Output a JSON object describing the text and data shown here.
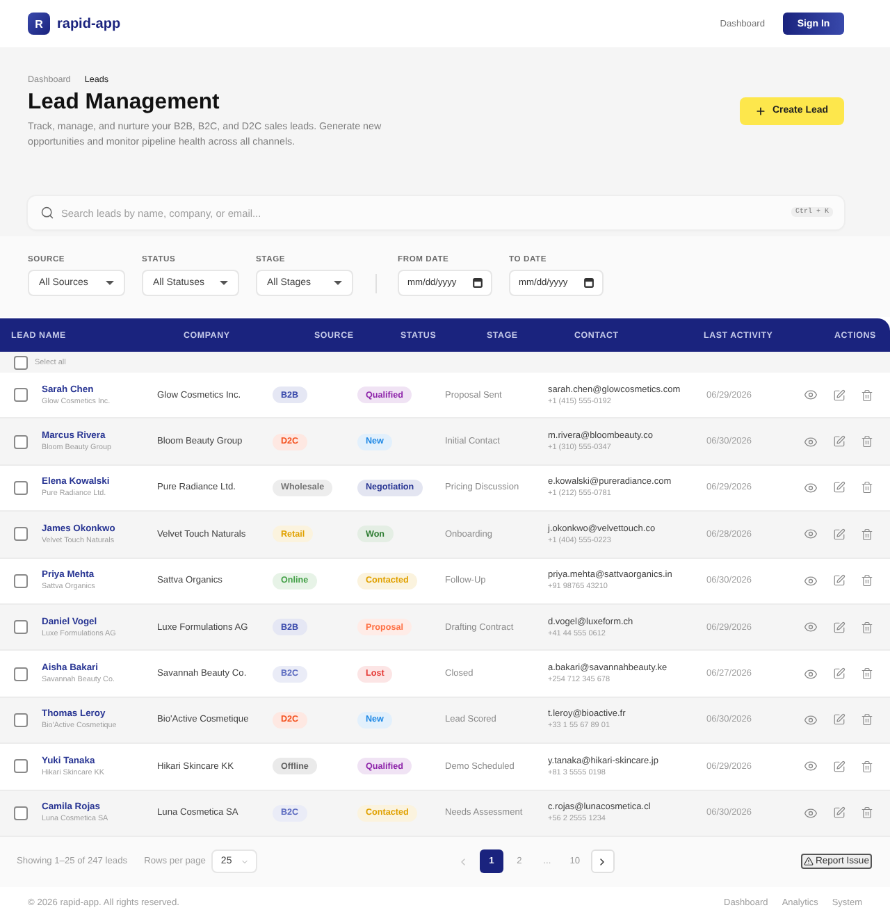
{
  "header": {
    "brand": {
      "logo_letter": "R",
      "name": "rapid-app"
    },
    "nav_links": [
      "Dashboard"
    ],
    "sign_in_button": "Sign In"
  },
  "page_header": {
    "breadcrumbs": [
      {
        "label": "Dashboard",
        "selected": false
      },
      {
        "label": "Leads",
        "selected": true
      }
    ],
    "title": "Lead Management",
    "description": "Track, manage, and nurture your B2B, B2C, and D2C sales leads. Generate new opportunities and monitor pipeline health across all channels.",
    "create_button": "Create Lead"
  },
  "search": {
    "placeholder": "Search leads by name, company, or email...",
    "shortcut": "Ctrl + K"
  },
  "filters": [
    {
      "kind": "select",
      "label": "SOURCE",
      "value": "All Sources"
    },
    {
      "kind": "select",
      "label": "STATUS",
      "value": "All Statuses"
    },
    {
      "kind": "select",
      "label": "STAGE",
      "value": "All Stages"
    },
    {
      "kind": "date",
      "label": "FROM DATE",
      "placeholder": "mm/dd/yyyy"
    },
    {
      "kind": "date",
      "label": "TO DATE",
      "placeholder": "mm/dd/yyyy"
    }
  ],
  "table": {
    "columns": [
      "LEAD NAME",
      "COMPANY",
      "SOURCE",
      "STATUS",
      "STAGE",
      "CONTACT",
      "LAST ACTIVITY",
      "ACTIONS"
    ],
    "select_all": {
      "label": "Select all",
      "checked": false
    },
    "rows": [
      {
        "name": "Sarah Chen",
        "subtitle": "Glow Cosmetics Inc.",
        "company": "Glow Cosmetics Inc.",
        "source": {
          "label": "B2B",
          "color": "#3949ab"
        },
        "status": {
          "label": "Qualified",
          "color": "#8e24aa"
        },
        "stage": "Proposal Sent",
        "email": "sarah.chen@glowcosmetics.com",
        "phone": "+1 (415) 555-0192",
        "last_activity": "06/29/2026",
        "checked": false
      },
      {
        "name": "Marcus Rivera",
        "subtitle": "Bloom Beauty Group",
        "company": "Bloom Beauty Group",
        "source": {
          "label": "D2C",
          "color": "#f4511e"
        },
        "status": {
          "label": "New",
          "color": "#1e88e5"
        },
        "stage": "Initial Contact",
        "email": "m.rivera@bloombeauty.co",
        "phone": "+1 (310) 555-0347",
        "last_activity": "06/30/2026",
        "checked": false
      },
      {
        "name": "Elena Kowalski",
        "subtitle": "Pure Radiance Ltd.",
        "company": "Pure Radiance Ltd.",
        "source": {
          "label": "Wholesale",
          "color": "#757575"
        },
        "status": {
          "label": "Negotiation",
          "color": "#283593"
        },
        "stage": "Pricing Discussion",
        "email": "e.kowalski@pureradiance.com",
        "phone": "+1 (212) 555-0781",
        "last_activity": "06/29/2026",
        "checked": false
      },
      {
        "name": "James Okonkwo",
        "subtitle": "Velvet Touch Naturals",
        "company": "Velvet Touch Naturals",
        "source": {
          "label": "Retail",
          "color": "#e0a100"
        },
        "status": {
          "label": "Won",
          "color": "#2e7d32"
        },
        "stage": "Onboarding",
        "email": "j.okonkwo@velvettouch.co",
        "phone": "+1 (404) 555-0223",
        "last_activity": "06/28/2026",
        "checked": false
      },
      {
        "name": "Priya Mehta",
        "subtitle": "Sattva Organics",
        "company": "Sattva Organics",
        "source": {
          "label": "Online",
          "color": "#43a047"
        },
        "status": {
          "label": "Contacted",
          "color": "#e0a100"
        },
        "stage": "Follow-Up",
        "email": "priya.mehta@sattvaorganics.in",
        "phone": "+91 98765 43210",
        "last_activity": "06/30/2026",
        "checked": false
      },
      {
        "name": "Daniel Vogel",
        "subtitle": "Luxe Formulations AG",
        "company": "Luxe Formulations AG",
        "source": {
          "label": "B2B",
          "color": "#3949ab"
        },
        "status": {
          "label": "Proposal",
          "color": "#ff7043"
        },
        "stage": "Drafting Contract",
        "email": "d.vogel@luxeform.ch",
        "phone": "+41 44 555 0612",
        "last_activity": "06/29/2026",
        "checked": false
      },
      {
        "name": "Aisha Bakari",
        "subtitle": "Savannah Beauty Co.",
        "company": "Savannah Beauty Co.",
        "source": {
          "label": "B2C",
          "color": "#5c6bc0"
        },
        "status": {
          "label": "Lost",
          "color": "#e53935"
        },
        "stage": "Closed",
        "email": "a.bakari@savannahbeauty.ke",
        "phone": "+254 712 345 678",
        "last_activity": "06/27/2026",
        "checked": false
      },
      {
        "name": "Thomas Leroy",
        "subtitle": "Bio'Active Cosmetique",
        "company": "Bio'Active Cosmetique",
        "source": {
          "label": "D2C",
          "color": "#f4511e"
        },
        "status": {
          "label": "New",
          "color": "#1e88e5"
        },
        "stage": "Lead Scored",
        "email": "t.leroy@bioactive.fr",
        "phone": "+33 1 55 67 89 01",
        "last_activity": "06/30/2026",
        "checked": false
      },
      {
        "name": "Yuki Tanaka",
        "subtitle": "Hikari Skincare KK",
        "company": "Hikari Skincare KK",
        "source": {
          "label": "Offline",
          "color": "#616161"
        },
        "status": {
          "label": "Qualified",
          "color": "#8e24aa"
        },
        "stage": "Demo Scheduled",
        "email": "y.tanaka@hikari-skincare.jp",
        "phone": "+81 3 5555 0198",
        "last_activity": "06/29/2026",
        "checked": false
      },
      {
        "name": "Camila Rojas",
        "subtitle": "Luna Cosmetica SA",
        "company": "Luna Cosmetica SA",
        "source": {
          "label": "B2C",
          "color": "#5c6bc0"
        },
        "status": {
          "label": "Contacted",
          "color": "#e0a100"
        },
        "stage": "Needs Assessment",
        "email": "c.rojas@lunacosmetica.cl",
        "phone": "+56 2 2555 1234",
        "last_activity": "06/30/2026",
        "checked": false
      }
    ]
  },
  "pagination": {
    "summary": "Showing 1–25 of 247 leads",
    "rows_per_page_label": "Rows per page",
    "rows_per_page": "25",
    "prev_button": {
      "disabled": true
    },
    "pages": [
      {
        "kind": "page",
        "label": "1",
        "selected": true
      },
      {
        "kind": "page",
        "label": "2",
        "selected": false
      },
      {
        "kind": "ellipsis",
        "label": "...",
        "selected": false
      },
      {
        "kind": "page",
        "label": "10",
        "selected": false
      }
    ],
    "next_button": {
      "disabled": false
    },
    "report_button": "Report Issue"
  },
  "footer": {
    "copyright": "© 2026 rapid-app. All rights reserved.",
    "links": [
      "Dashboard",
      "Analytics",
      "System"
    ]
  }
}
